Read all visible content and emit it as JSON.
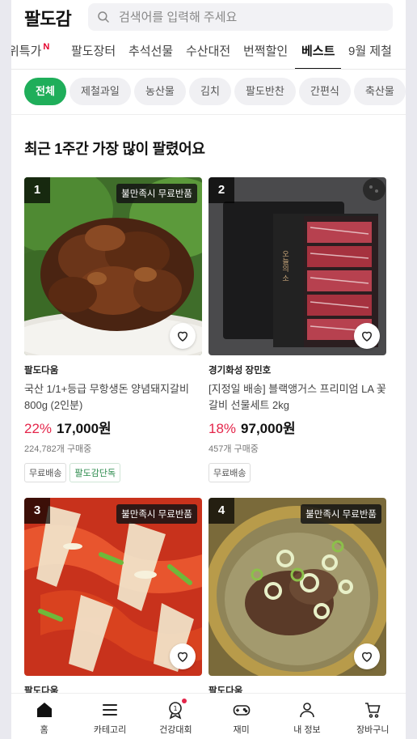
{
  "header": {
    "logo": "팔도감",
    "search_placeholder": "검색어를 입력해 주세요"
  },
  "tabs": [
    {
      "label": "위특가",
      "new_mark": "N"
    },
    {
      "label": "팔도장터"
    },
    {
      "label": "추석선물"
    },
    {
      "label": "수산대전"
    },
    {
      "label": "번쩍할인"
    },
    {
      "label": "베스트",
      "active": true
    },
    {
      "label": "9월 제철"
    }
  ],
  "chips": [
    {
      "label": "전체",
      "active": true
    },
    {
      "label": "제철과일"
    },
    {
      "label": "농산물"
    },
    {
      "label": "김치"
    },
    {
      "label": "팔도반찬"
    },
    {
      "label": "간편식"
    },
    {
      "label": "축산물"
    }
  ],
  "section_title": "최근 1주간 가장 많이 팔렸어요",
  "products": [
    {
      "rank": "1",
      "promo": "불만족시 무료반품",
      "seller": "팔도다움",
      "name": "국산 1/1+등급 무항생돈 양념돼지갈비 800g (2인분)",
      "discount": "22%",
      "price": "17,000원",
      "sold": "224,782개 구매중",
      "badges": [
        "무료배송",
        "팔도감단독"
      ],
      "image": "grilled-pork-ribs"
    },
    {
      "rank": "2",
      "seller": "경기화성 장민호",
      "name": "[지정일 배송] 블랙앵거스 프리미엄 LA 꽃갈비 선물세트 2kg",
      "discount": "18%",
      "price": "97,000원",
      "sold": "457개 구매중",
      "badges": [
        "무료배송"
      ],
      "image": "la-galbi-gift-box",
      "box_text": "오늘의 소"
    },
    {
      "rank": "3",
      "promo": "불만족시 무료반품",
      "seller": "팔도다움",
      "image": "kimchi"
    },
    {
      "rank": "4",
      "promo": "불만족시 무료반품",
      "seller": "팔도다움",
      "image": "beef-soup"
    }
  ],
  "bottom_nav": [
    {
      "label": "홈",
      "icon": "home-icon"
    },
    {
      "label": "카테고리",
      "icon": "menu-icon"
    },
    {
      "label": "건강대회",
      "icon": "medal-icon",
      "badge_dot": true,
      "medal_text": "1"
    },
    {
      "label": "재미",
      "icon": "gamepad-icon"
    },
    {
      "label": "내 정보",
      "icon": "user-icon"
    },
    {
      "label": "장바구니",
      "icon": "cart-icon"
    }
  ],
  "colors": {
    "accent_green": "#1fae5a",
    "discount_red": "#e4254a",
    "new_badge_red": "#e4002b"
  }
}
